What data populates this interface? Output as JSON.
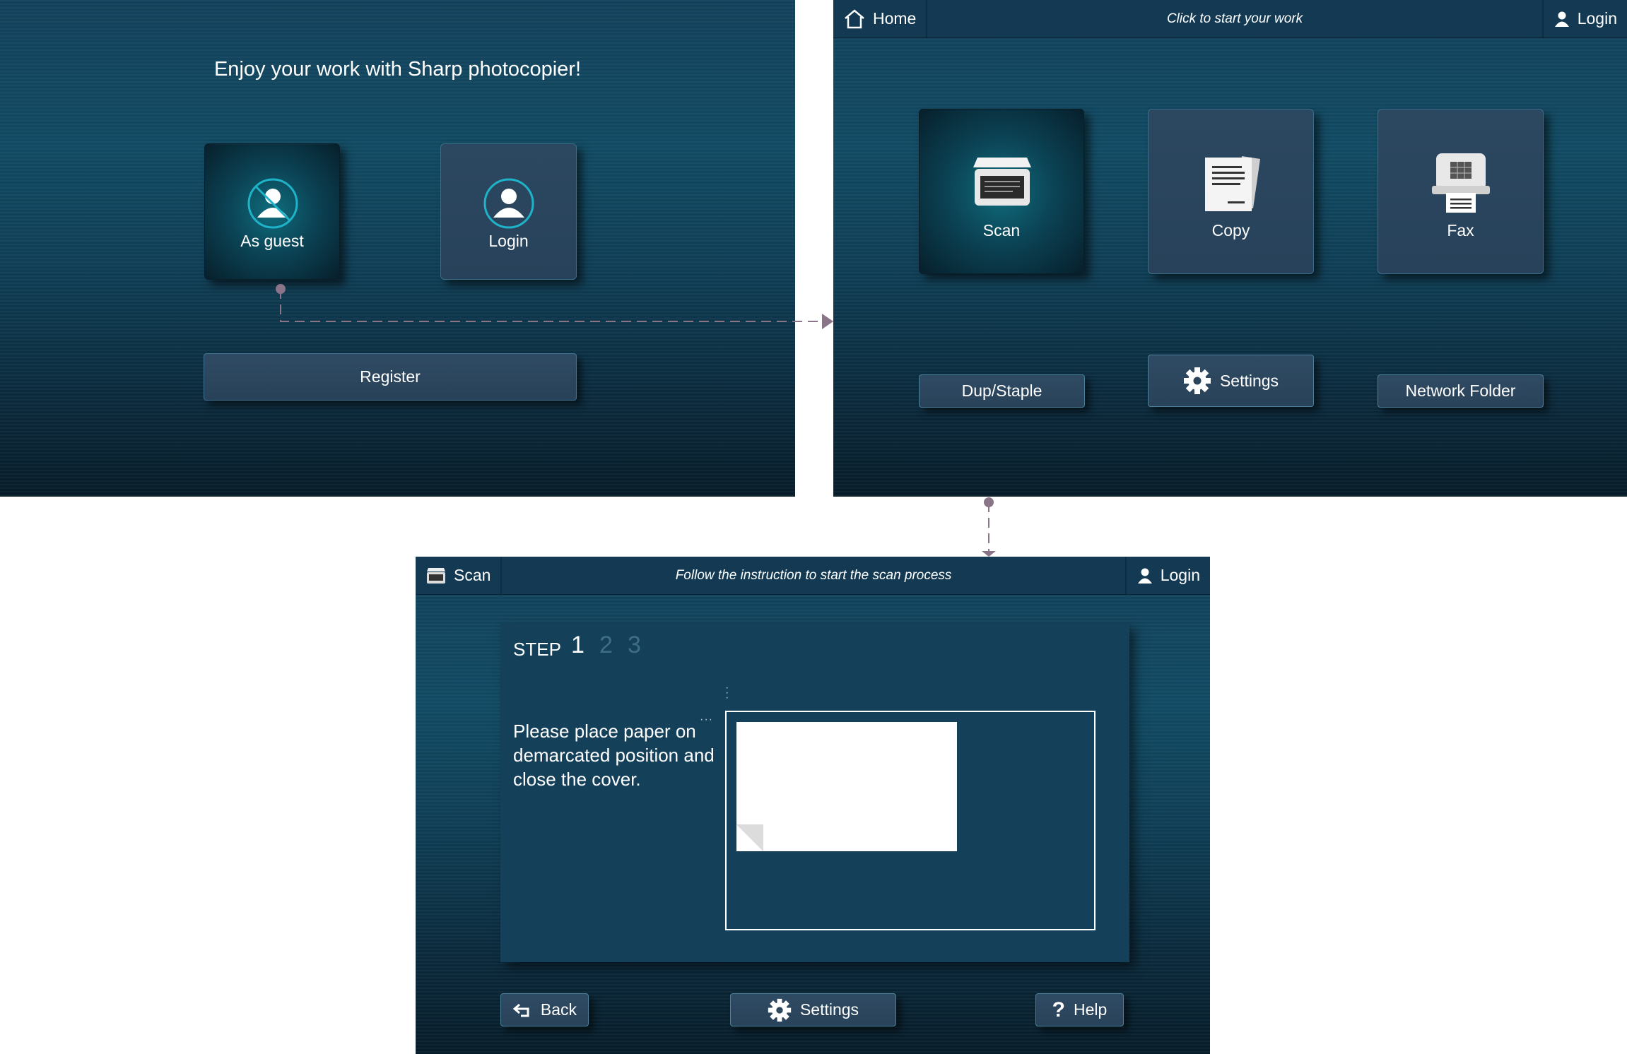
{
  "screen1": {
    "title": "Enjoy your work with Sharp photocopier!",
    "tiles": [
      {
        "label": "As guest",
        "icon": "guest-user-icon"
      },
      {
        "label": "Login",
        "icon": "user-icon"
      }
    ],
    "register_label": "Register"
  },
  "screen2": {
    "topbar": {
      "home_label": "Home",
      "message": "Click to start your work",
      "login_label": "Login"
    },
    "tiles": [
      {
        "label": "Scan",
        "icon": "scanner-icon"
      },
      {
        "label": "Copy",
        "icon": "copy-documents-icon"
      },
      {
        "label": "Fax",
        "icon": "fax-icon"
      }
    ],
    "buttons": {
      "dup_staple": "Dup/Staple",
      "settings": "Settings",
      "network_folder": "Network Folder"
    }
  },
  "screen3": {
    "topbar": {
      "scan_label": "Scan",
      "message": "Follow the instruction to start the scan process",
      "login_label": "Login"
    },
    "step_label": "STEP",
    "steps": [
      "1",
      "2",
      "3"
    ],
    "current_step": 1,
    "instruction": "Please place paper on demarcated position and close the cover.",
    "buttons": {
      "back": "Back",
      "settings": "Settings",
      "help": "Help"
    }
  },
  "colors": {
    "accent": "#1fb3c9",
    "panel_dark": "#0b2a3c",
    "connector": "#8a7488"
  }
}
